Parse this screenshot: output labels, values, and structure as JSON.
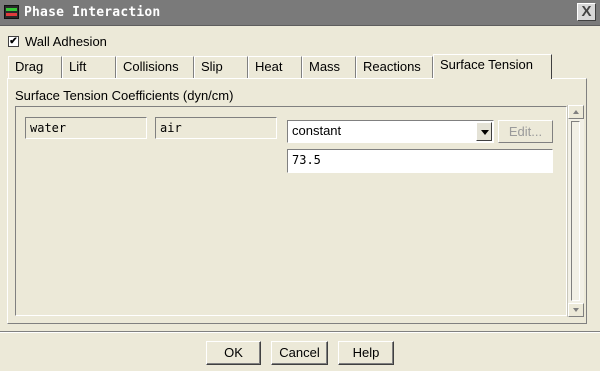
{
  "window": {
    "title": "Phase Interaction",
    "close_glyph": "X"
  },
  "options": {
    "wall_adhesion_label": "Wall Adhesion",
    "wall_adhesion_checked": true,
    "check_glyph": "✔"
  },
  "tabs": [
    {
      "label": "Drag",
      "active": false
    },
    {
      "label": "Lift",
      "active": false
    },
    {
      "label": "Collisions",
      "active": false
    },
    {
      "label": "Slip",
      "active": false
    },
    {
      "label": "Heat",
      "active": false
    },
    {
      "label": "Mass",
      "active": false
    },
    {
      "label": "Reactions",
      "active": false
    },
    {
      "label": "Surface Tension",
      "active": true
    }
  ],
  "surface_tension": {
    "section_label": "Surface Tension Coefficients (dyn/cm)",
    "phase_1": "water",
    "phase_2": "air",
    "method": "constant",
    "edit_label": "Edit...",
    "value": "73.5"
  },
  "buttons": {
    "ok": "OK",
    "cancel": "Cancel",
    "help": "Help"
  },
  "icons": {
    "title": "fluent-app-icon",
    "close": "close-icon",
    "dropdown": "chevron-down-icon",
    "scroll_up": "arrow-up-icon",
    "scroll_down": "arrow-down-icon"
  }
}
